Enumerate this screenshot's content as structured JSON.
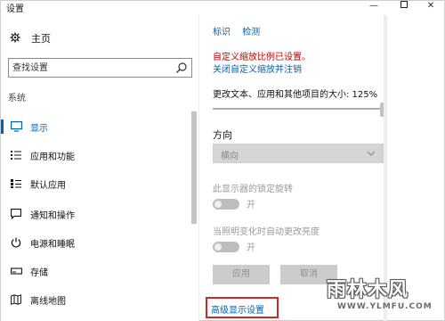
{
  "window": {
    "title": "设置",
    "minimize": "—",
    "close": "✕"
  },
  "sidebar": {
    "home_label": "主页",
    "search_placeholder": "查找设置",
    "section_label": "系统",
    "items": [
      {
        "label": "显示",
        "icon": "monitor-icon",
        "active": true
      },
      {
        "label": "应用和功能",
        "icon": "list-icon"
      },
      {
        "label": "默认应用",
        "icon": "list-check-icon"
      },
      {
        "label": "通知和操作",
        "icon": "message-icon"
      },
      {
        "label": "电源和睡眠",
        "icon": "power-icon"
      },
      {
        "label": "存储",
        "icon": "drive-icon"
      },
      {
        "label": "离线地图",
        "icon": "map-icon"
      }
    ]
  },
  "main": {
    "top_links": [
      "标识",
      "检测"
    ],
    "warning": "自定义缩放比例已设置。",
    "disable_custom_link": "关闭自定义缩放并注销",
    "scale_label": "更改文本、应用和其他项目的大小: 125%",
    "scale_value_percent": 125,
    "orientation_label": "方向",
    "orientation_value": "横向",
    "rotation_lock_label": "此显示器的锁定旋转",
    "rotation_lock_state": "开",
    "brightness_label": "当照明变化时自动更改亮度",
    "brightness_state": "开",
    "apply_label": "应用",
    "cancel_label": "取消",
    "advanced_link": "高级显示设置"
  },
  "watermark": {
    "text": "雨林木风",
    "url": "WWW.YLMFU.COM"
  },
  "colors": {
    "accent": "#0063b1",
    "warning": "#c00000",
    "highlight_box": "#cc2a2a"
  }
}
